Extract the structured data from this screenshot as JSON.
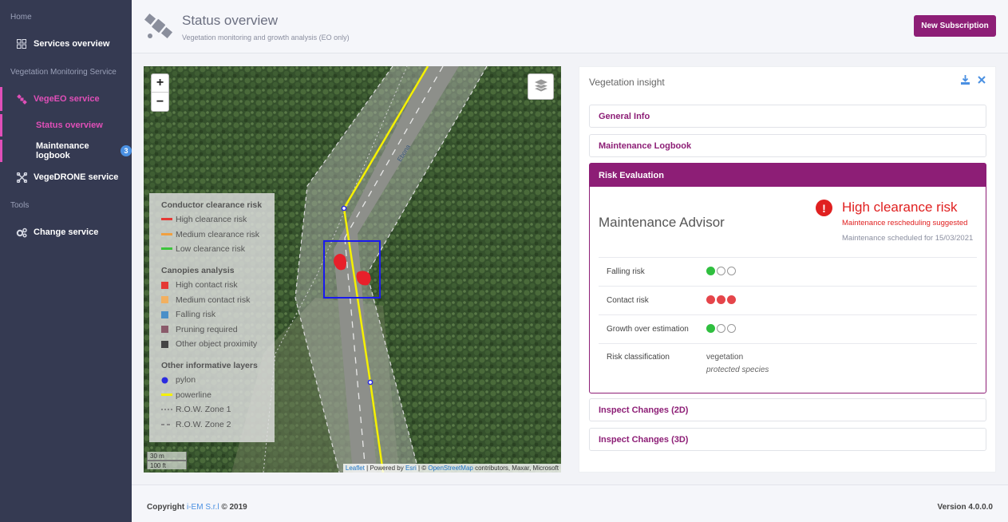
{
  "sidebar": {
    "section_home": "Home",
    "services_overview": "Services overview",
    "section_vms": "Vegetation Monitoring Service",
    "vegeeo": "VegeEO service",
    "status_overview": "Status overview",
    "maintenance_logbook": "Maintenance logbook",
    "logbook_badge": "3",
    "vegedrone": "VegeDRONE service",
    "section_tools": "Tools",
    "change_service": "Change service"
  },
  "header": {
    "title": "Status overview",
    "subtitle": "Vegetation monitoring and growth analysis (EO only)",
    "new_subscription": "New Subscription"
  },
  "map": {
    "zoom_in": "+",
    "zoom_out": "−",
    "road_label": "Ebona",
    "scale_m": "30 m",
    "scale_ft": "100 ft",
    "attrib_leaflet": "Leaflet",
    "attrib_mid1": " | Powered by ",
    "attrib_esri": "Esri",
    "attrib_mid2": " | © ",
    "attrib_osm": "OpenStreetMap",
    "attrib_tail": " contributors, Maxar, Microsoft",
    "legend": {
      "conductor_title": "Conductor clearance risk",
      "high_clearance": "High clearance risk",
      "medium_clearance": "Medium clearance risk",
      "low_clearance": "Low clearance risk",
      "canopies_title": "Canopies analysis",
      "high_contact": "High contact risk",
      "medium_contact": "Medium contact risk",
      "falling": "Falling risk",
      "pruning": "Pruning required",
      "other_object": "Other object proximity",
      "other_title": "Other informative layers",
      "pylon": "pylon",
      "powerline": "powerline",
      "row1": "R.O.W. Zone 1",
      "row2": "R.O.W. Zone 2"
    },
    "colors": {
      "high": "#e53935",
      "medium": "#f0a040",
      "low": "#3cc43c",
      "high_contact": "#e53935",
      "medium_contact": "#f2b060",
      "falling": "#4a8fc8",
      "pruning": "#8a5a6a",
      "other_object": "#444444",
      "pylon": "#2a2ae0",
      "powerline": "#f5f000"
    }
  },
  "panel": {
    "title": "Vegetation insight",
    "general_info": "General Info",
    "maintenance_logbook": "Maintenance Logbook",
    "risk_evaluation": "Risk Evaluation",
    "advisor_title": "Maintenance Advisor",
    "risk_title": "High clearance risk",
    "risk_sub": "Maintenance rescheduling suggested",
    "risk_sched": "Maintenance scheduled for 15/03/2021",
    "rows": {
      "falling": "Falling risk",
      "contact": "Contact risk",
      "growth": "Growth over estimation",
      "classification": "Risk classification",
      "class_value": "vegetation",
      "class_note": "protected species"
    },
    "levels": {
      "falling": 1,
      "contact": 3,
      "growth": 1,
      "max": 3
    },
    "inspect_2d": "Inspect Changes (2D)",
    "inspect_3d": "Inspect Changes (3D)"
  },
  "footer": {
    "copyright_prefix": "Copyright ",
    "company": "i-EM S.r.l",
    "copyright_suffix": " © 2019",
    "version": "Version 4.0.0.0"
  }
}
